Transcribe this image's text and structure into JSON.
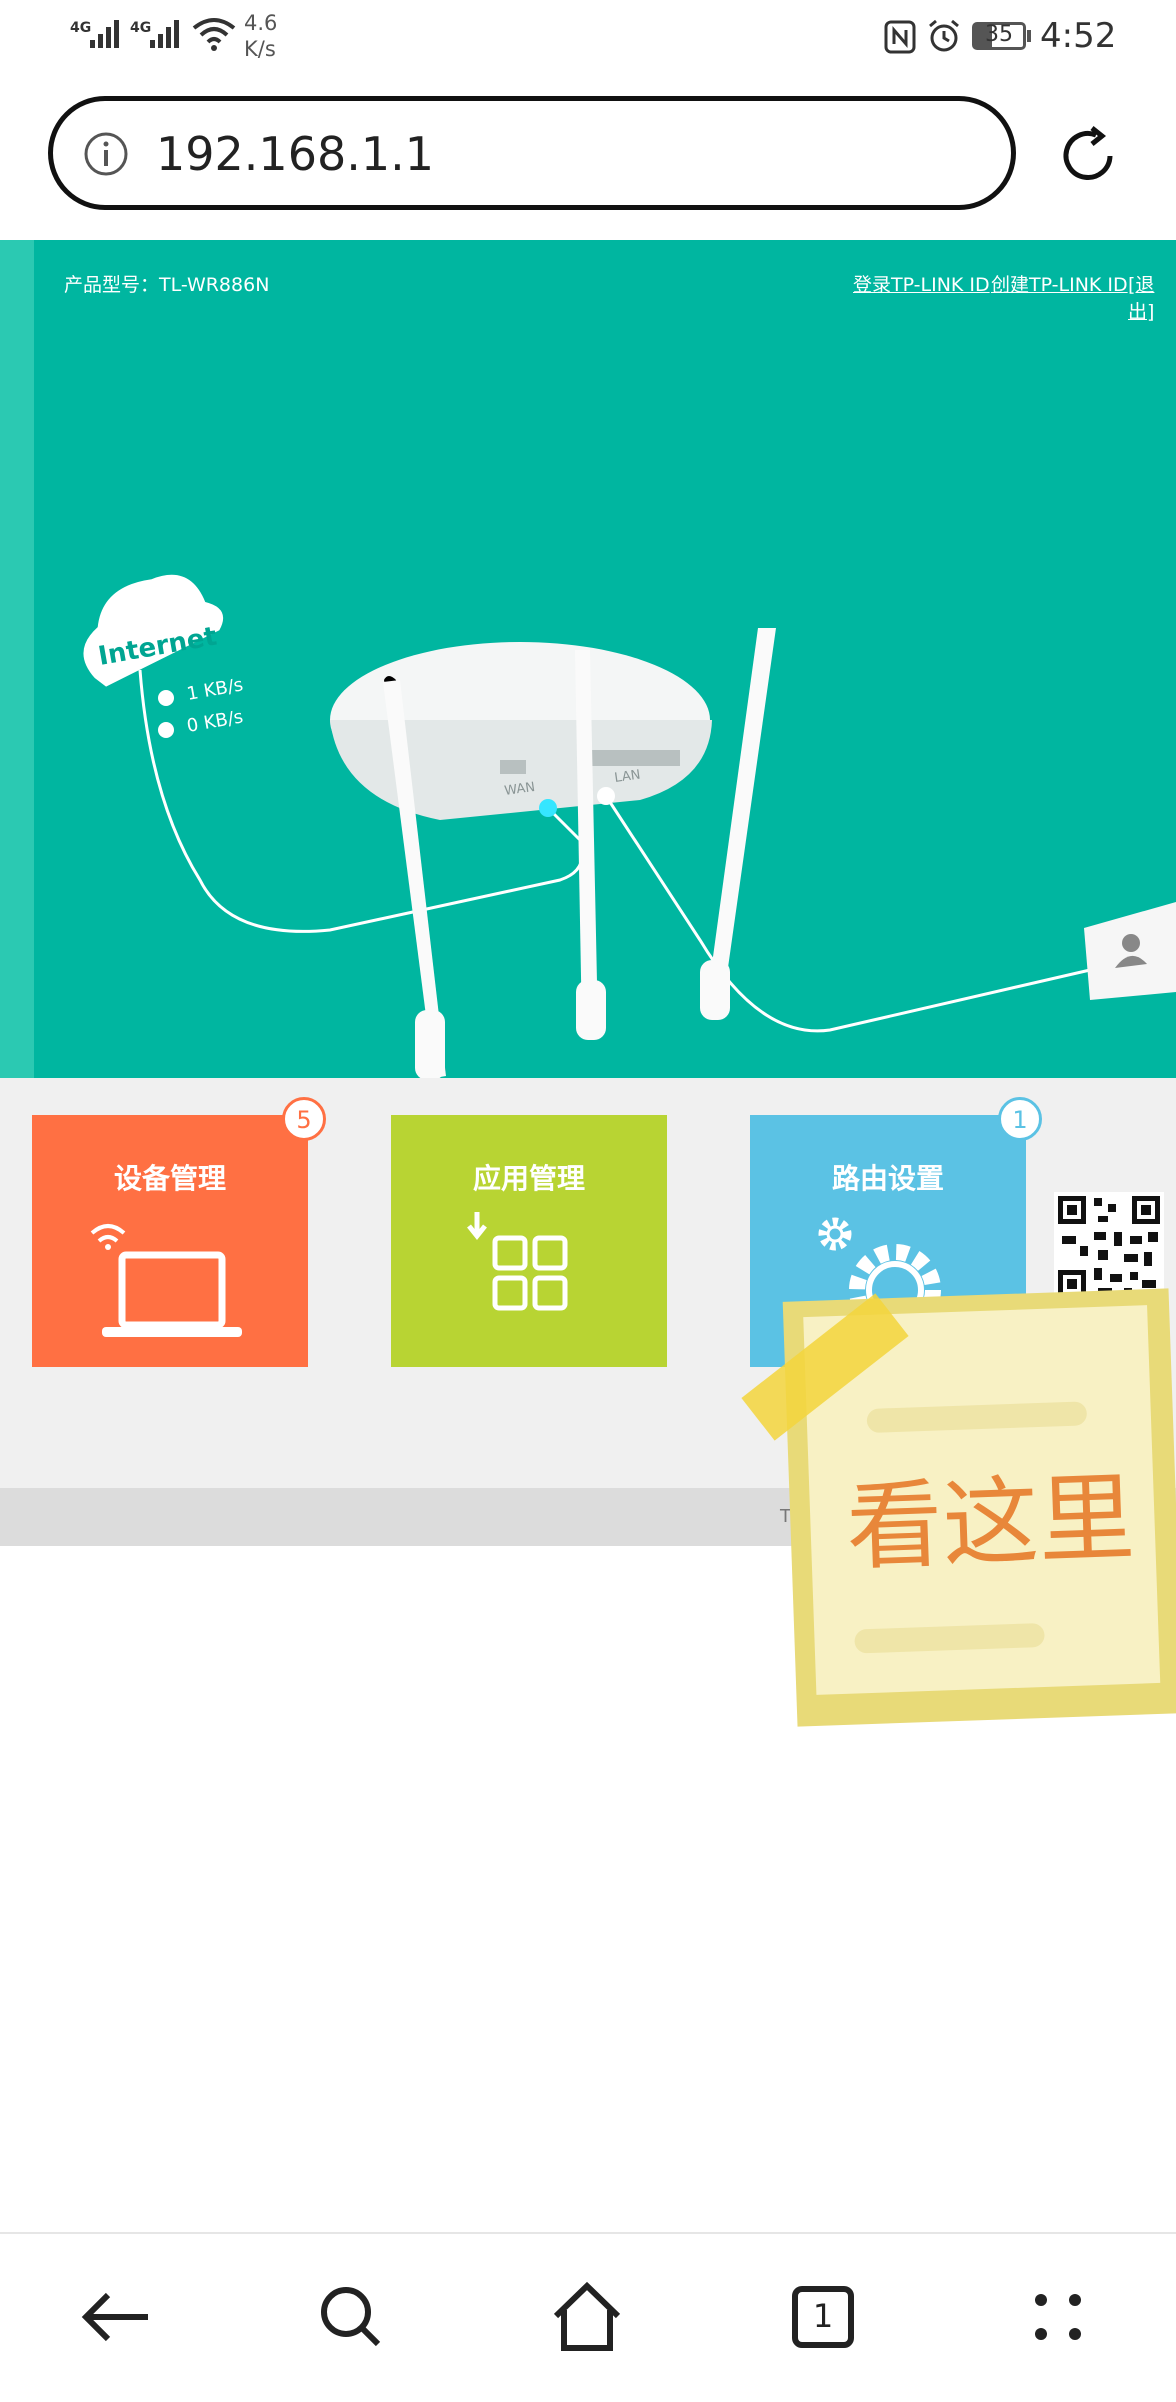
{
  "status_bar": {
    "signal1": "4G",
    "signal2": "4G",
    "speed_value": "4.6",
    "speed_unit": "K/s",
    "battery": "35",
    "time": "4:52"
  },
  "browser": {
    "url": "192.168.1.1",
    "tab_count": "1"
  },
  "router": {
    "model_label": "产品型号：TL-WR886N",
    "login_link": "登录TP-LINK ID",
    "create_link": "创建TP-LINK ID",
    "logout_link": "[退出]",
    "internet_label": "Internet",
    "upload_speed": "1 KB/s",
    "download_speed": "0 KB/s",
    "wan_label": "WAN",
    "lan_label": "LAN"
  },
  "tiles": [
    {
      "label": "设备管理",
      "badge": "5",
      "color": "#FF7043"
    },
    {
      "label": "应用管理",
      "badge": "",
      "color": "#B8D433"
    },
    {
      "label": "路由设置",
      "badge": "1",
      "color": "#5BC2E4"
    }
  ],
  "footer": {
    "text": "TP-"
  },
  "sticky_note": {
    "text": "看这里"
  },
  "colors": {
    "teal": "#00B6A0",
    "orange": "#FF7043",
    "lime": "#B8D433",
    "sky": "#5BC2E4",
    "note_text": "#E8873A"
  }
}
